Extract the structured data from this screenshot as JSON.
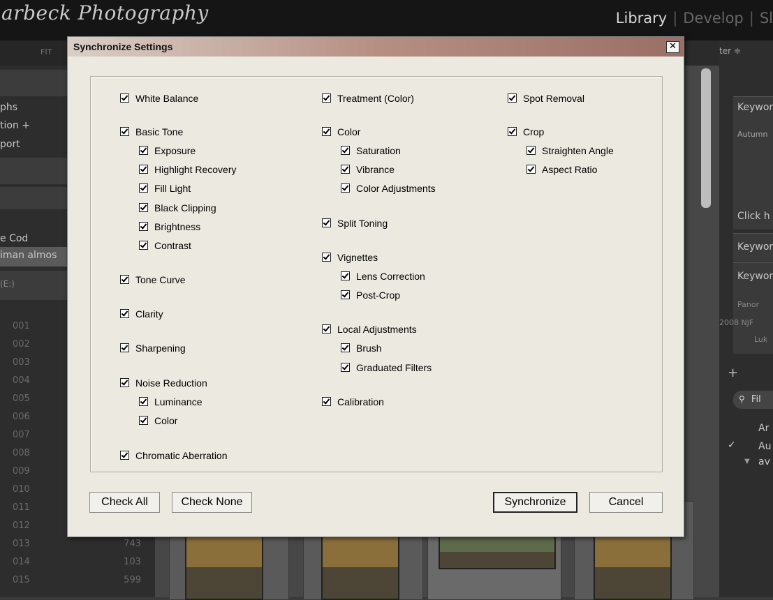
{
  "app": {
    "identity_plate": "arbeck Photography",
    "modules": [
      "Library",
      "Develop",
      "Sl"
    ],
    "active_module": "Library"
  },
  "left_panel": {
    "toolbar_text": "FIT",
    "rows": [
      "phs",
      "tion +",
      "port"
    ],
    "folder_rows": [
      "e Cod",
      "iman almos",
      "(E:)"
    ],
    "folder_nums": [
      "001",
      "002",
      "003",
      "004",
      "005",
      "006",
      "007",
      "008",
      "009",
      "010",
      "011",
      "012",
      "013",
      "014",
      "015"
    ],
    "counts": {
      "013": "743",
      "014": "103",
      "015": "599"
    }
  },
  "right_panel": {
    "sort_text": "ter ≑",
    "keyword_rows": [
      "Keywor",
      "Autumn",
      "Click h",
      "Keywor",
      "Keywor",
      "Panor",
      "2008 NJF",
      "Luk"
    ],
    "filter_label": "Fil",
    "keyword_list": [
      "Ar",
      "Au",
      "av"
    ]
  },
  "dialog": {
    "title": "Synchronize Settings",
    "close_glyph": "✕",
    "columns": [
      [
        {
          "label": "White Balance",
          "checked": true,
          "indent": false
        },
        {
          "label": "Basic Tone",
          "checked": true,
          "indent": false
        },
        {
          "label": "Exposure",
          "checked": true,
          "indent": true
        },
        {
          "label": "Highlight Recovery",
          "checked": true,
          "indent": true
        },
        {
          "label": "Fill Light",
          "checked": true,
          "indent": true
        },
        {
          "label": "Black Clipping",
          "checked": true,
          "indent": true
        },
        {
          "label": "Brightness",
          "checked": true,
          "indent": true
        },
        {
          "label": "Contrast",
          "checked": true,
          "indent": true
        },
        {
          "label": "Tone Curve",
          "checked": true,
          "indent": false
        },
        {
          "label": "Clarity",
          "checked": true,
          "indent": false
        },
        {
          "label": "Sharpening",
          "checked": true,
          "indent": false
        },
        {
          "label": "Noise Reduction",
          "checked": true,
          "indent": false
        },
        {
          "label": "Luminance",
          "checked": true,
          "indent": true
        },
        {
          "label": "Color",
          "checked": true,
          "indent": true
        },
        {
          "label": "Chromatic Aberration",
          "checked": true,
          "indent": false
        }
      ],
      [
        {
          "label": "Treatment (Color)",
          "checked": true,
          "indent": false
        },
        {
          "label": "Color",
          "checked": true,
          "indent": false
        },
        {
          "label": "Saturation",
          "checked": true,
          "indent": true
        },
        {
          "label": "Vibrance",
          "checked": true,
          "indent": true
        },
        {
          "label": "Color Adjustments",
          "checked": true,
          "indent": true
        },
        {
          "label": "Split Toning",
          "checked": true,
          "indent": false
        },
        {
          "label": "Vignettes",
          "checked": true,
          "indent": false
        },
        {
          "label": "Lens Correction",
          "checked": true,
          "indent": true
        },
        {
          "label": "Post-Crop",
          "checked": true,
          "indent": true
        },
        {
          "label": "Local Adjustments",
          "checked": true,
          "indent": false
        },
        {
          "label": "Brush",
          "checked": true,
          "indent": true
        },
        {
          "label": "Graduated Filters",
          "checked": true,
          "indent": true
        },
        {
          "label": "Calibration",
          "checked": true,
          "indent": false
        }
      ],
      [
        {
          "label": "Spot Removal",
          "checked": true,
          "indent": false
        },
        {
          "label": "Crop",
          "checked": true,
          "indent": false
        },
        {
          "label": "Straighten Angle",
          "checked": true,
          "indent": true
        },
        {
          "label": "Aspect Ratio",
          "checked": true,
          "indent": true
        }
      ]
    ],
    "buttons": {
      "check_all": "Check All",
      "check_none": "Check None",
      "synchronize": "Synchronize",
      "cancel": "Cancel"
    }
  }
}
